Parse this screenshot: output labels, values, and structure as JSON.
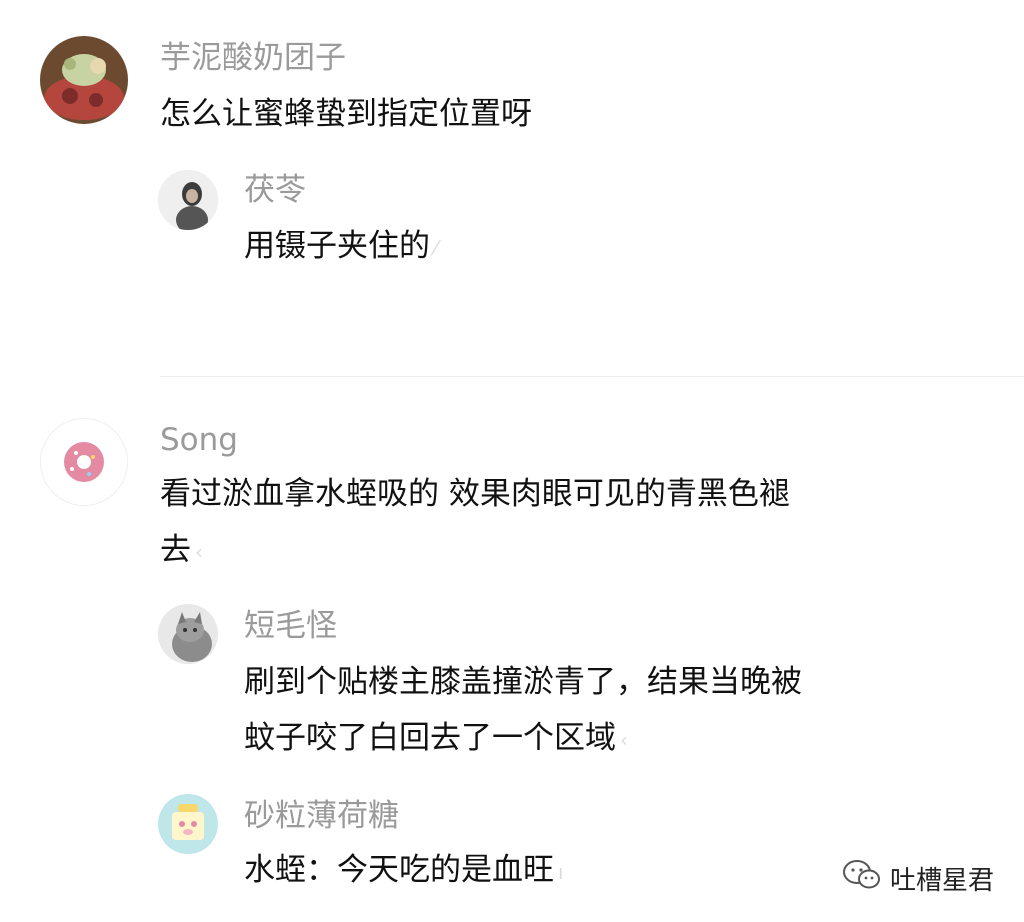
{
  "comments": [
    {
      "username": "芋泥酸奶团子",
      "text": "怎么让蜜蜂蛰到指定位置呀",
      "replies": [
        {
          "username": "茯苓",
          "text": "用镊子夹住的"
        }
      ]
    },
    {
      "username": "Song",
      "text_line1": "看过淤血拿水蛭吸的 效果肉眼可见的青黑色褪",
      "text_line2": "去",
      "replies": [
        {
          "username": "短毛怪",
          "text_line1": "刷到个贴楼主膝盖撞淤青了，结果当晚被",
          "text_line2": "蚊子咬了白回去了一个区域"
        },
        {
          "username": "砂粒薄荷糖",
          "text": "水蛭：今天吃的是血旺"
        }
      ]
    }
  ],
  "watermark": {
    "icon": "wechat-icon",
    "text": "吐槽星君"
  },
  "colors": {
    "username": "#9a9a9a",
    "text": "#111111",
    "divider": "#eeeeee"
  }
}
